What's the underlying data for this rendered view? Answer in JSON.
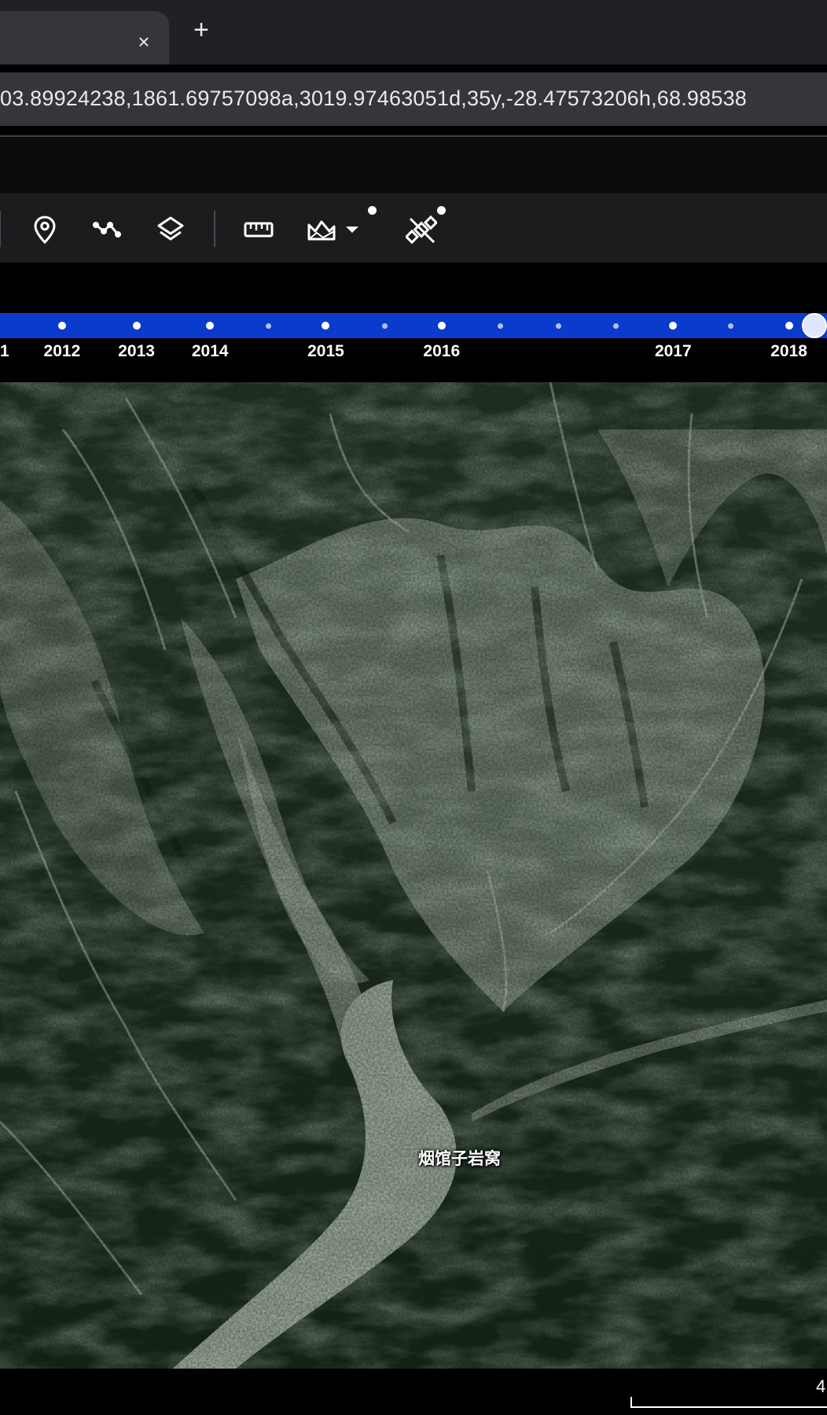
{
  "browser": {
    "new_tab_label": "+",
    "close_glyph": "×",
    "url": "03.89924238,1861.69757098a,3019.97463051d,35y,-28.47573206h,68.98538"
  },
  "toolbar": {
    "tools": [
      {
        "name": "placemark-icon"
      },
      {
        "name": "path-icon"
      },
      {
        "name": "layers-icon"
      },
      {
        "name": "ruler-icon"
      },
      {
        "name": "historical-imagery-icon"
      },
      {
        "name": "satellite-icon"
      }
    ]
  },
  "timeline": {
    "years": [
      {
        "label": "1",
        "pos": 0.004
      },
      {
        "label": "2012",
        "pos": 0.075
      },
      {
        "label": "2013",
        "pos": 0.165
      },
      {
        "label": "2014",
        "pos": 0.254
      },
      {
        "label": "2015",
        "pos": 0.394
      },
      {
        "label": "2016",
        "pos": 0.534
      },
      {
        "label": "2017",
        "pos": 0.814
      },
      {
        "label": "2018",
        "pos": 0.954
      }
    ],
    "dots": [
      {
        "pos": 0.075,
        "major": true
      },
      {
        "pos": 0.165,
        "major": true
      },
      {
        "pos": 0.254,
        "major": true
      },
      {
        "pos": 0.325,
        "major": false
      },
      {
        "pos": 0.394,
        "major": true
      },
      {
        "pos": 0.465,
        "major": false
      },
      {
        "pos": 0.534,
        "major": true
      },
      {
        "pos": 0.605,
        "major": false
      },
      {
        "pos": 0.675,
        "major": false
      },
      {
        "pos": 0.745,
        "major": false
      },
      {
        "pos": 0.814,
        "major": true
      },
      {
        "pos": 0.884,
        "major": false
      },
      {
        "pos": 0.954,
        "major": true
      }
    ],
    "selected_pos": 1.024
  },
  "map": {
    "place_label": "烟馆子岩窝"
  },
  "footer": {
    "scale_text": "4"
  }
}
